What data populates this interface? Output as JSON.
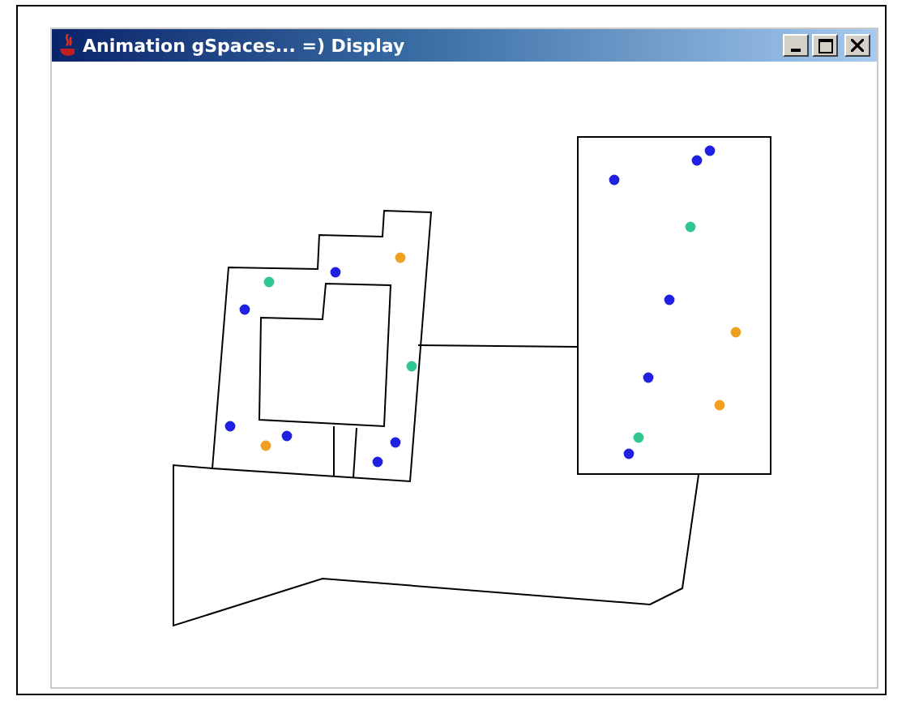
{
  "window": {
    "title": "Animation gSpaces... =) Display"
  },
  "agents": [
    {
      "color": "#30c890"
    },
    {
      "color": "#2020e0"
    },
    {
      "color": "#f0a020"
    },
    {
      "color": "#2020e0"
    },
    {
      "color": "#30c890"
    },
    {
      "color": "#2020e0"
    },
    {
      "color": "#2020e0"
    },
    {
      "color": "#f0a020"
    },
    {
      "color": "#2020e0"
    },
    {
      "color": "#2020e0"
    },
    {
      "color": "#2020e0"
    },
    {
      "color": "#2020e0"
    },
    {
      "color": "#2020e0"
    },
    {
      "color": "#30c890"
    },
    {
      "color": "#2020e0"
    },
    {
      "color": "#f0a020"
    },
    {
      "color": "#2020e0"
    },
    {
      "color": "#f0a020"
    },
    {
      "color": "#30c890"
    },
    {
      "color": "#2020e0"
    }
  ]
}
